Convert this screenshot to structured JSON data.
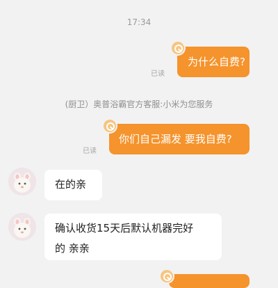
{
  "chat": {
    "timestamp": "17:34",
    "messages": [
      {
        "from": "customer",
        "text": "为什么自费?",
        "read_status": "已读"
      },
      {
        "from": "customer",
        "text": "你们自己漏发  要我自费?",
        "read_status": "已读"
      },
      {
        "from": "service",
        "text": "在的亲"
      },
      {
        "from": "service",
        "lines": [
          "确认收货15天后默认机器完好",
          "的 亲亲"
        ]
      }
    ],
    "service_notice": "(厨卫）奥普浴霸官方客服:小米为您服务"
  },
  "colors": {
    "outgoing_bubble": "#f5932c",
    "incoming_bubble": "#ffffff",
    "background": "#f2f2f2"
  },
  "icons": {
    "sender_badge": "customer-badge-icon",
    "service_avatar": "service-avatar-icon"
  }
}
